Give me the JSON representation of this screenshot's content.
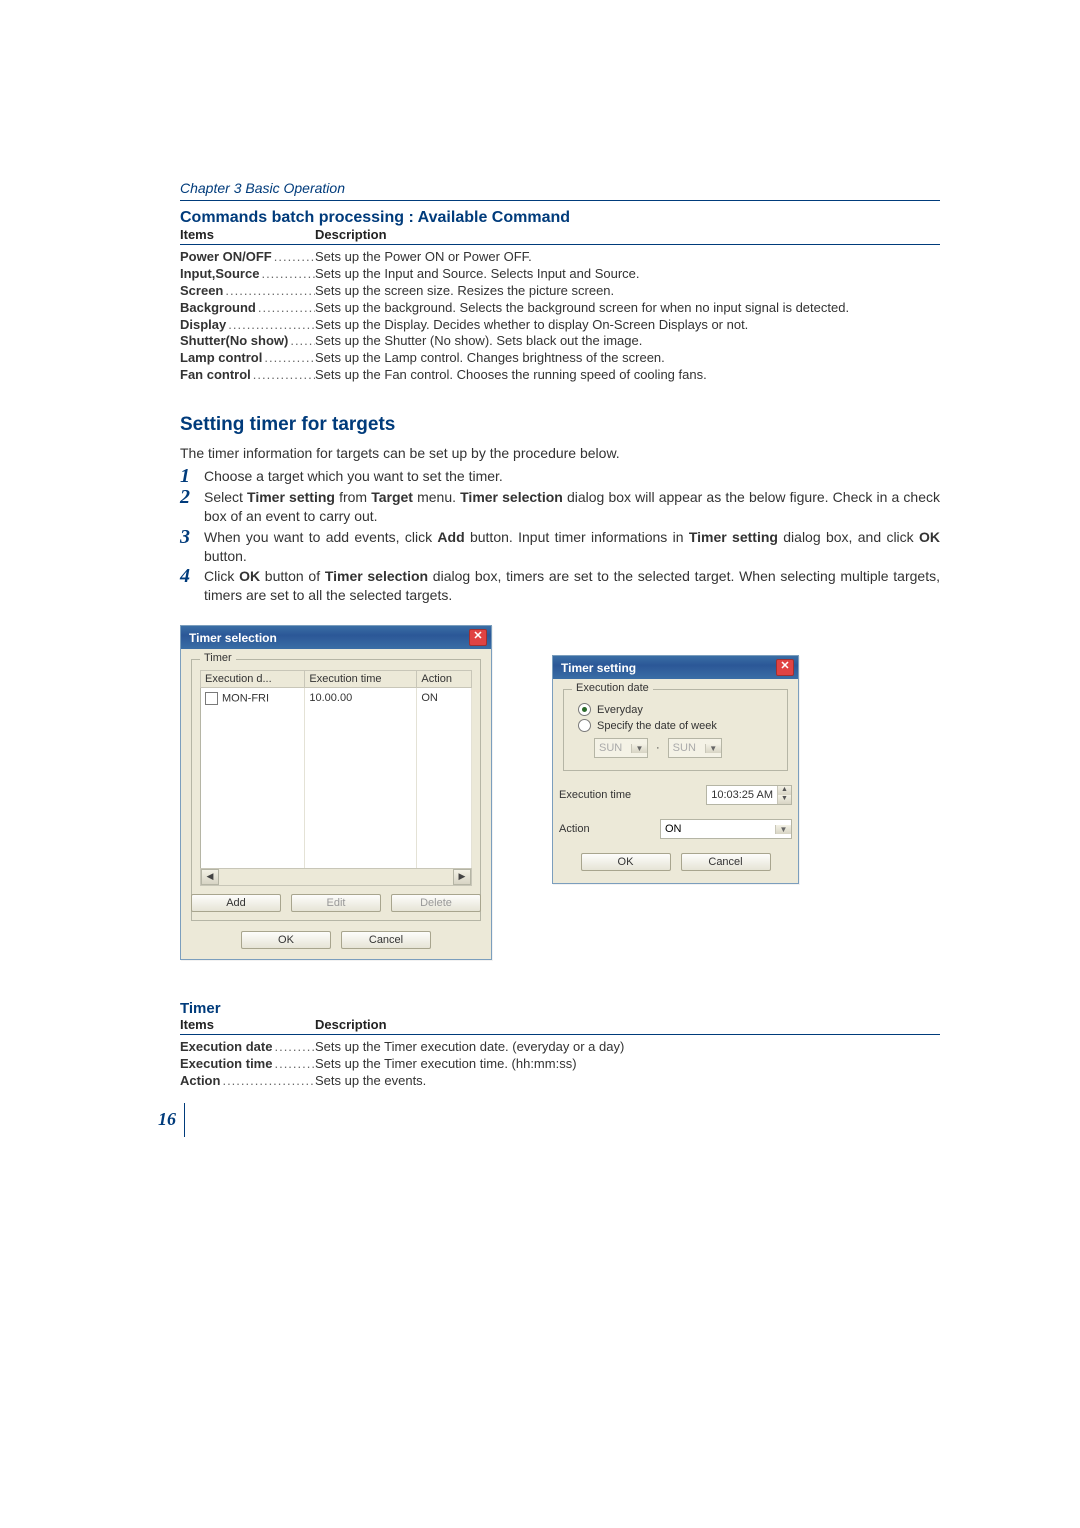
{
  "chapter": "Chapter 3 Basic Operation",
  "cmd_section_title": "Commands batch processing : Available Command",
  "table_header": {
    "items": "Items",
    "description": "Description"
  },
  "commands": [
    {
      "item": "Power ON/OFF",
      "desc": "Sets up the Power ON or Power OFF."
    },
    {
      "item": "Input,Source",
      "desc": "Sets up the Input and Source. Selects Input and Source."
    },
    {
      "item": "Screen",
      "desc": "Sets up the screen size. Resizes the picture screen."
    },
    {
      "item": "Background",
      "desc": "Sets up the background. Selects the background screen for when no input signal is detected."
    },
    {
      "item": "Display",
      "desc": "Sets up the Display. Decides whether to display On-Screen Displays or not."
    },
    {
      "item": "Shutter(No show)",
      "desc": "Sets up the Shutter (No show). Sets black out the image."
    },
    {
      "item": "Lamp control",
      "desc": "Sets up the Lamp control. Changes brightness of the screen."
    },
    {
      "item": "Fan control",
      "desc": "Sets up the Fan control. Chooses the running speed of cooling fans."
    }
  ],
  "subsection_title": "Setting timer for targets",
  "intro": "The timer information for targets can be set up by the procedure below.",
  "step1": "Choose a target which you want to set the timer.",
  "step2_a": "Select ",
  "step2_b": "Timer setting",
  "step2_c": " from ",
  "step2_d": "Target",
  "step2_e": " menu. ",
  "step2_f": "Timer selection",
  "step2_g": " dialog box will appear as the below figure. Check in a check box of an event to carry out.",
  "step3_a": "When you want to add events, click ",
  "step3_b": "Add",
  "step3_c": " button. Input timer informations in ",
  "step3_d": "Timer setting",
  "step3_e": " dialog box, and click ",
  "step3_f": "OK",
  "step3_g": " button.",
  "step4_a": "Click ",
  "step4_b": "OK",
  "step4_c": " button of ",
  "step4_d": "Timer selection",
  "step4_e": " dialog box, timers are set to the selected target. When selecting multiple targets, timers are set to all the selected targets.",
  "dlg1": {
    "title": "Timer selection",
    "group": "Timer",
    "cols": {
      "c1": "Execution d...",
      "c2": "Execution time",
      "c3": "Action"
    },
    "row": {
      "c1": "MON-FRI",
      "c2": "10.00.00",
      "c3": "ON"
    },
    "add": "Add",
    "edit": "Edit",
    "delete": "Delete",
    "ok": "OK",
    "cancel": "Cancel"
  },
  "dlg2": {
    "title": "Timer setting",
    "group": "Execution date",
    "opt_everyday": "Everyday",
    "opt_specify": "Specify the date of week",
    "day": "SUN",
    "sep": "·",
    "exec_time_label": "Execution time",
    "exec_time_value": "10:03:25 AM",
    "action_label": "Action",
    "action_value": "ON",
    "ok": "OK",
    "cancel": "Cancel"
  },
  "timer_section_title": "Timer",
  "timer_items": [
    {
      "item": "Execution date",
      "desc": "Sets up the Timer execution date.  (everyday or a day)"
    },
    {
      "item": "Execution time",
      "desc": "Sets up the Timer execution time. (hh:mm:ss)"
    },
    {
      "item": "Action",
      "desc": "Sets up the events."
    }
  ],
  "page_number": "16"
}
